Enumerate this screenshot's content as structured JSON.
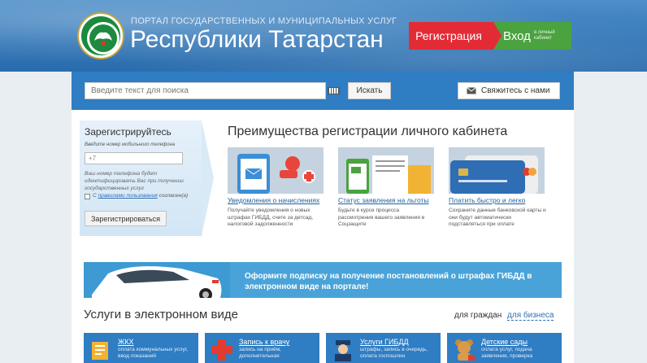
{
  "header": {
    "small_title": "ПОРТАЛ ГОСУДАРСТВЕННЫХ И МУНИЦИПАЛЬНЫХ УСЛУГ",
    "big_title": "Республики Татарстан",
    "register_label": "Регистрация",
    "login_label": "Вход",
    "login_sub": "в личный кабинет"
  },
  "search": {
    "placeholder": "Введите текст для поиска",
    "button": "Искать",
    "contact": "Свяжитесь с нами"
  },
  "register": {
    "title": "Зарегистрируйтесь",
    "hint": "Введите номер мобильного телефона",
    "phone_value": "+7",
    "note": "Ваш номер телефона будет идентифицировать Вас при получении государственных услуг",
    "agree_prefix": "С ",
    "agree_link": "правилами пользования",
    "agree_suffix": " согласен(а)",
    "button": "Зарегистрироваться"
  },
  "advantages": {
    "title": "Преимущества регистрации личного кабинета",
    "cards": [
      {
        "title": "Уведомления о начислениях",
        "text": "Получайте уведомления о новых штрафах ГИБДД, счете за детсад, налоговой задолженности"
      },
      {
        "title": "Статус заявления на льготы",
        "text": "Будьте в курсе процесса рассмотрения вашего заявления в Соцзащите"
      },
      {
        "title": "Платить быстро и легко",
        "text": "Сохраните данные банковской карты и они будут автоматически подставляться при оплате"
      }
    ]
  },
  "banner": {
    "text": "Оформите подписку на получение постановлений о штрафах ГИБДД в электронном виде на портале!"
  },
  "services": {
    "title": "Услуги в электронном виде",
    "for_citizens": "для граждан",
    "for_business": "для бизнеса",
    "tiles": [
      {
        "title": "ЖКХ",
        "desc": "оплата коммунальных услуг, ввод показаний"
      },
      {
        "title": "Запись к врачу",
        "desc": "запись на приём, дополнительная"
      },
      {
        "title": "Услуги ГИБДД",
        "desc": "штрафы, запись в очередь, оплата госпошлин"
      },
      {
        "title": "Детские сады",
        "desc": "оплата услуг, подача заявления, проверка"
      }
    ]
  },
  "colors": {
    "header": "#2f74b5",
    "register": "#e32b36",
    "login": "#4aa33f",
    "banner": "#4aa3d8"
  }
}
